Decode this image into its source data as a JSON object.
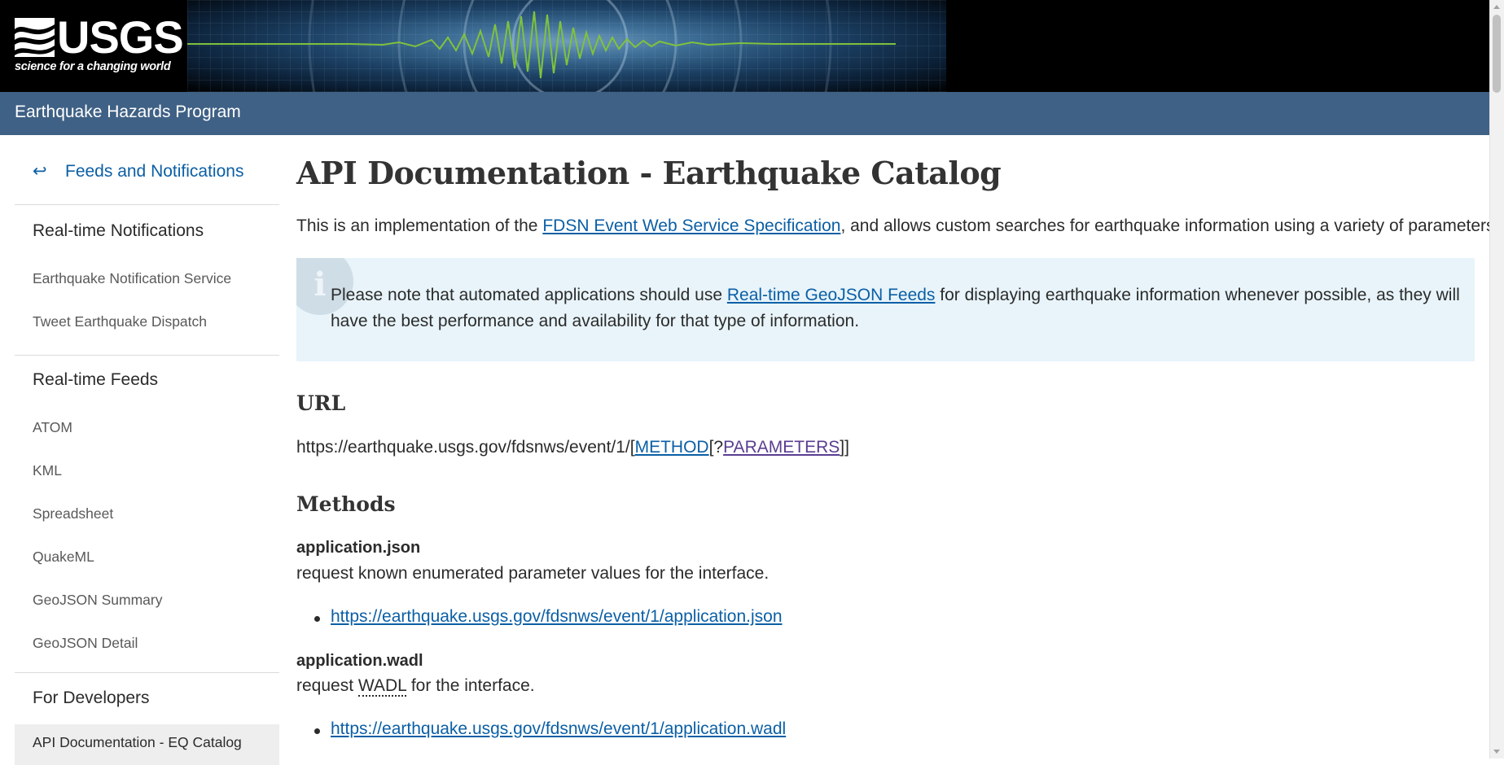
{
  "header": {
    "logo_text": "USGS",
    "logo_tagline": "science for a changing world",
    "program": "Earthquake Hazards Program"
  },
  "sidebar": {
    "back_link": {
      "arrow": "↩",
      "label": "Feeds and Notifications"
    },
    "sections": [
      {
        "heading": "Real-time Notifications",
        "items": [
          "Earthquake Notification Service",
          "Tweet Earthquake Dispatch"
        ]
      },
      {
        "heading": "Real-time Feeds",
        "items": [
          "ATOM",
          "KML",
          "Spreadsheet",
          "QuakeML",
          "GeoJSON Summary",
          "GeoJSON Detail"
        ]
      },
      {
        "heading": "For Developers",
        "items": [
          "API Documentation - EQ Catalog"
        ]
      }
    ],
    "active_item": "API Documentation - EQ Catalog"
  },
  "main": {
    "title": "API Documentation - Earthquake Catalog",
    "intro": {
      "before": "This is an implementation of the ",
      "link": "FDSN Event Web Service Specification",
      "after": ", and allows custom searches for earthquake information using a variety of parameters."
    },
    "alert": {
      "icon": "i",
      "before": "Please note that automated applications should use ",
      "link": "Real-time GeoJSON Feeds",
      "after": " for displaying earthquake information whenever possible, as they will have the best performance and availability for that type of information."
    },
    "url_section": {
      "heading": "URL",
      "base": "https://earthquake.usgs.gov/fdsnws/event/1/",
      "open_bracket": "[",
      "method": "METHOD",
      "optional_open": "[?",
      "parameters": "PARAMETERS",
      "close": "]]"
    },
    "methods_section": {
      "heading": "Methods",
      "methods": [
        {
          "name": "application.json",
          "desc_before": "request known enumerated parameter values for the interface.",
          "url": "https://earthquake.usgs.gov/fdsnws/event/1/application.json"
        },
        {
          "name": "application.wadl",
          "desc_before": "request ",
          "desc_abbr": "WADL",
          "desc_after": " for the interface.",
          "url": "https://earthquake.usgs.gov/fdsnws/event/1/application.wadl"
        }
      ]
    }
  },
  "colors": {
    "program_bar": "#3f6185",
    "link": "#0b5fa5",
    "visited_link": "#5a3d91",
    "alert_bg": "#e8f4fa",
    "sidebar_active_bg": "#eeeeee"
  }
}
